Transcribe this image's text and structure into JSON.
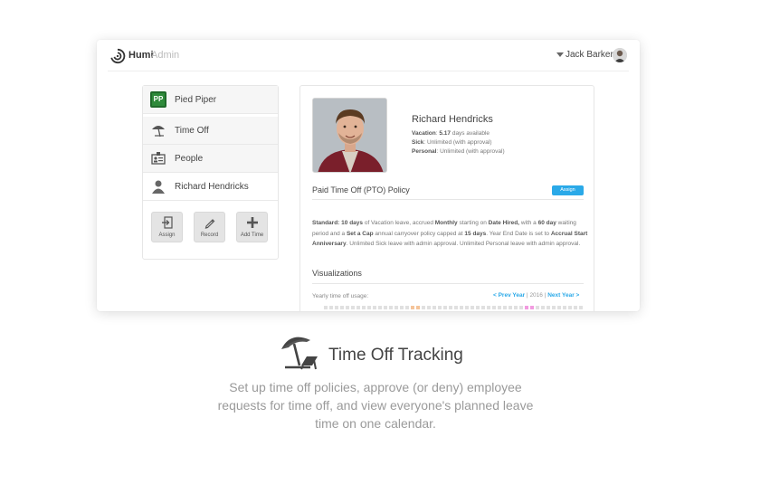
{
  "app": {
    "brand": "Humi",
    "brand_sub": "Admin"
  },
  "user": {
    "name": "Jack Barker"
  },
  "sidebar": {
    "items": [
      {
        "label": "Pied Piper",
        "icon": "pied-piper-logo-icon",
        "logo_text": "PP"
      },
      {
        "label": "Time Off",
        "icon": "umbrella-icon"
      },
      {
        "label": "People",
        "icon": "id-card-icon"
      },
      {
        "label": "Richard Hendricks",
        "icon": "person-icon"
      }
    ],
    "actions": [
      {
        "label": "Assign",
        "icon": "assign-icon"
      },
      {
        "label": "Record",
        "icon": "pencil-icon"
      },
      {
        "label": "Add Time",
        "icon": "plus-icon"
      }
    ]
  },
  "employee": {
    "name": "Richard Hendricks",
    "vacation_label": "Vacation",
    "vacation_value": "5.17",
    "vacation_suffix": "days available",
    "sick_label": "Sick",
    "sick_value": "Unlimited (with approval)",
    "personal_label": "Personal",
    "personal_value": "Unlimited (with approval)"
  },
  "policy": {
    "title": "Paid Time Off (PTO) Policy",
    "assign_label": "Assign",
    "text": {
      "standard": "Standard:",
      "days": "10 days",
      "t1": "of Vacation leave, accrued",
      "monthly": "Monthly",
      "t2": "starting on",
      "date_hired": "Date Hired,",
      "t3": "with a",
      "wait": "60 day",
      "t4": "waiting period and a",
      "cap": "Set a Cap",
      "t5": "annual carryover policy capped at",
      "cap_days": "15 days",
      "t6": ". Year End Date is set to",
      "anniv": "Accrual Start Anniversary",
      "t7": ". Unlimited Sick leave with admin approval. Unlimited Personal leave with admin approval."
    }
  },
  "visualizations": {
    "title": "Visualizations",
    "usage_label": "Yearly time off usage:",
    "prev": "< Prev Year",
    "year": "2016",
    "next": "Next Year >",
    "highlight_colors": {
      "orange": "#f5c49a",
      "pink": "#f29be0"
    }
  },
  "feature": {
    "icon": "beach-umbrella-chair-icon",
    "title": "Time Off Tracking",
    "description": "Set up time off policies, approve (or deny) employee requests for time off, and view everyone's planned leave time on one calendar."
  }
}
